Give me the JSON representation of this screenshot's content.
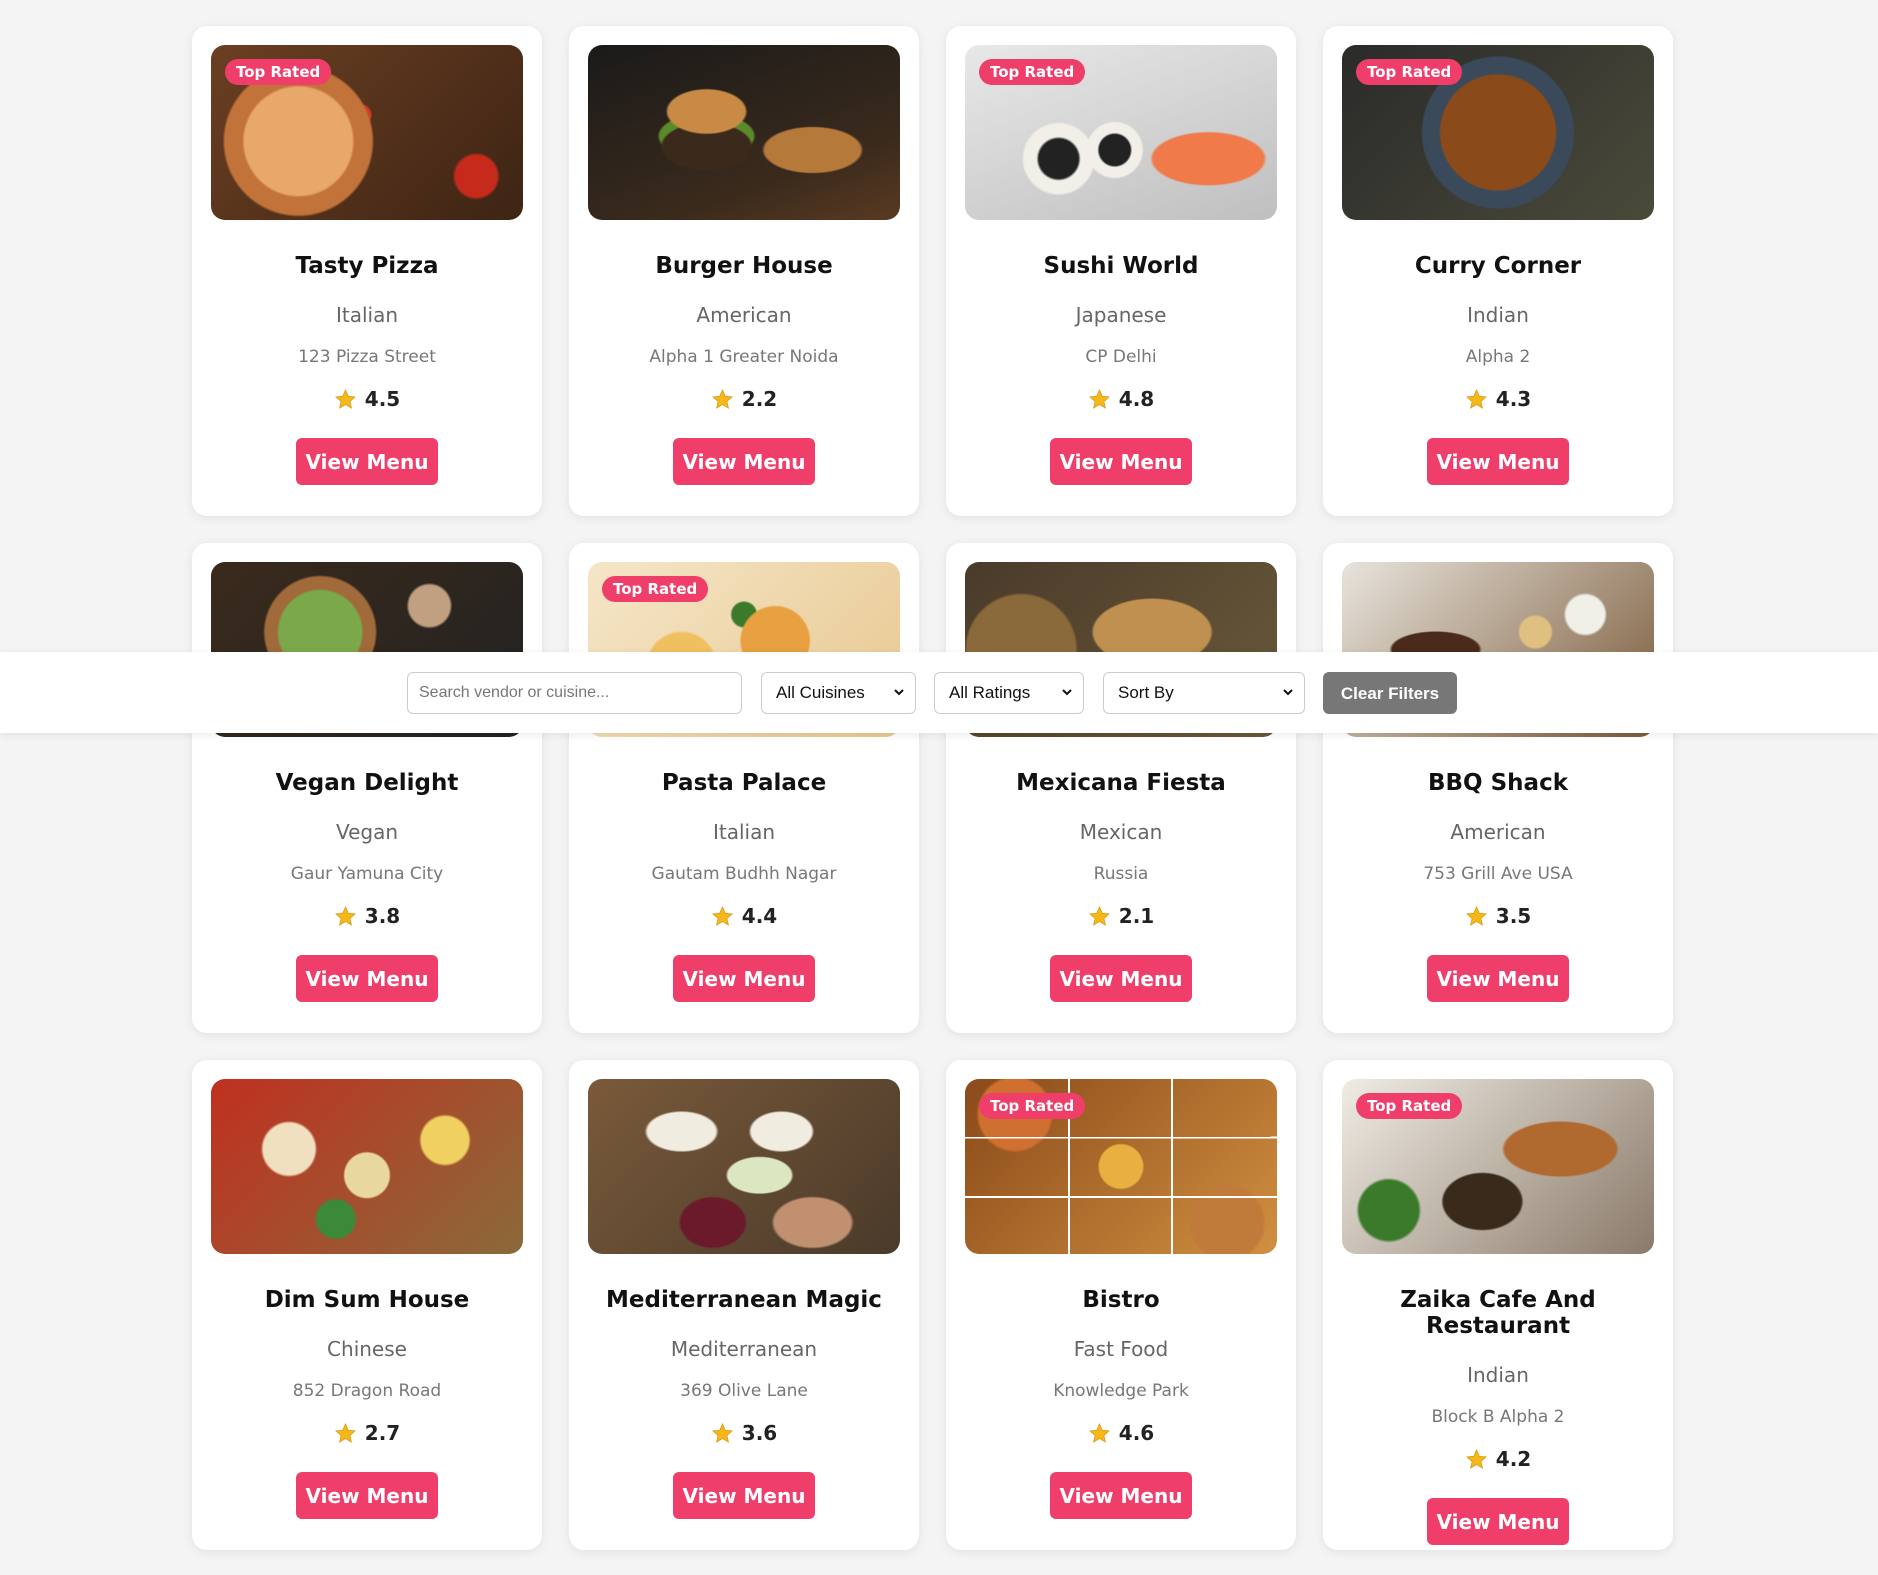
{
  "filters": {
    "search_placeholder": "Search vendor or cuisine...",
    "cuisine_select": "All Cuisines",
    "rating_select": "All Ratings",
    "sort_select": "Sort By",
    "clear_button": "Clear Filters"
  },
  "badge_label": "Top Rated",
  "button_label": "View Menu",
  "colors": {
    "accent": "#f03e6b",
    "star": "#f5b81b",
    "clear_button": "#777777"
  },
  "vendors": [
    {
      "name": "Tasty Pizza",
      "cuisine": "Italian",
      "address": "123 Pizza Street",
      "rating": "4.5",
      "top_rated": true,
      "image": "pizza"
    },
    {
      "name": "Burger House",
      "cuisine": "American",
      "address": "Alpha 1 Greater Noida",
      "rating": "2.2",
      "top_rated": false,
      "image": "burger"
    },
    {
      "name": "Sushi World",
      "cuisine": "Japanese",
      "address": "CP Delhi",
      "rating": "4.8",
      "top_rated": true,
      "image": "sushi"
    },
    {
      "name": "Curry Corner",
      "cuisine": "Indian",
      "address": "Alpha 2",
      "rating": "4.3",
      "top_rated": true,
      "image": "curry"
    },
    {
      "name": "Vegan Delight",
      "cuisine": "Vegan",
      "address": "Gaur Yamuna City",
      "rating": "3.8",
      "top_rated": false,
      "image": "vegan"
    },
    {
      "name": "Pasta Palace",
      "cuisine": "Italian",
      "address": "Gautam Budhh Nagar",
      "rating": "4.4",
      "top_rated": true,
      "image": "pasta"
    },
    {
      "name": "Mexicana Fiesta",
      "cuisine": "Mexican",
      "address": "Russia",
      "rating": "2.1",
      "top_rated": false,
      "image": "mexican"
    },
    {
      "name": "BBQ Shack",
      "cuisine": "American",
      "address": "753 Grill Ave USA",
      "rating": "3.5",
      "top_rated": false,
      "image": "bbq"
    },
    {
      "name": "Dim Sum House",
      "cuisine": "Chinese",
      "address": "852 Dragon Road",
      "rating": "2.7",
      "top_rated": false,
      "image": "dimsum"
    },
    {
      "name": "Mediterranean Magic",
      "cuisine": "Mediterranean",
      "address": "369 Olive Lane",
      "rating": "3.6",
      "top_rated": false,
      "image": "mediterranean"
    },
    {
      "name": "Bistro",
      "cuisine": "Fast Food",
      "address": "Knowledge Park",
      "rating": "4.6",
      "top_rated": true,
      "image": "fastfood"
    },
    {
      "name": "Zaika Cafe And Restaurant",
      "cuisine": "Indian",
      "address": "Block B Alpha 2",
      "rating": "4.2",
      "top_rated": true,
      "image": "zaika"
    }
  ]
}
